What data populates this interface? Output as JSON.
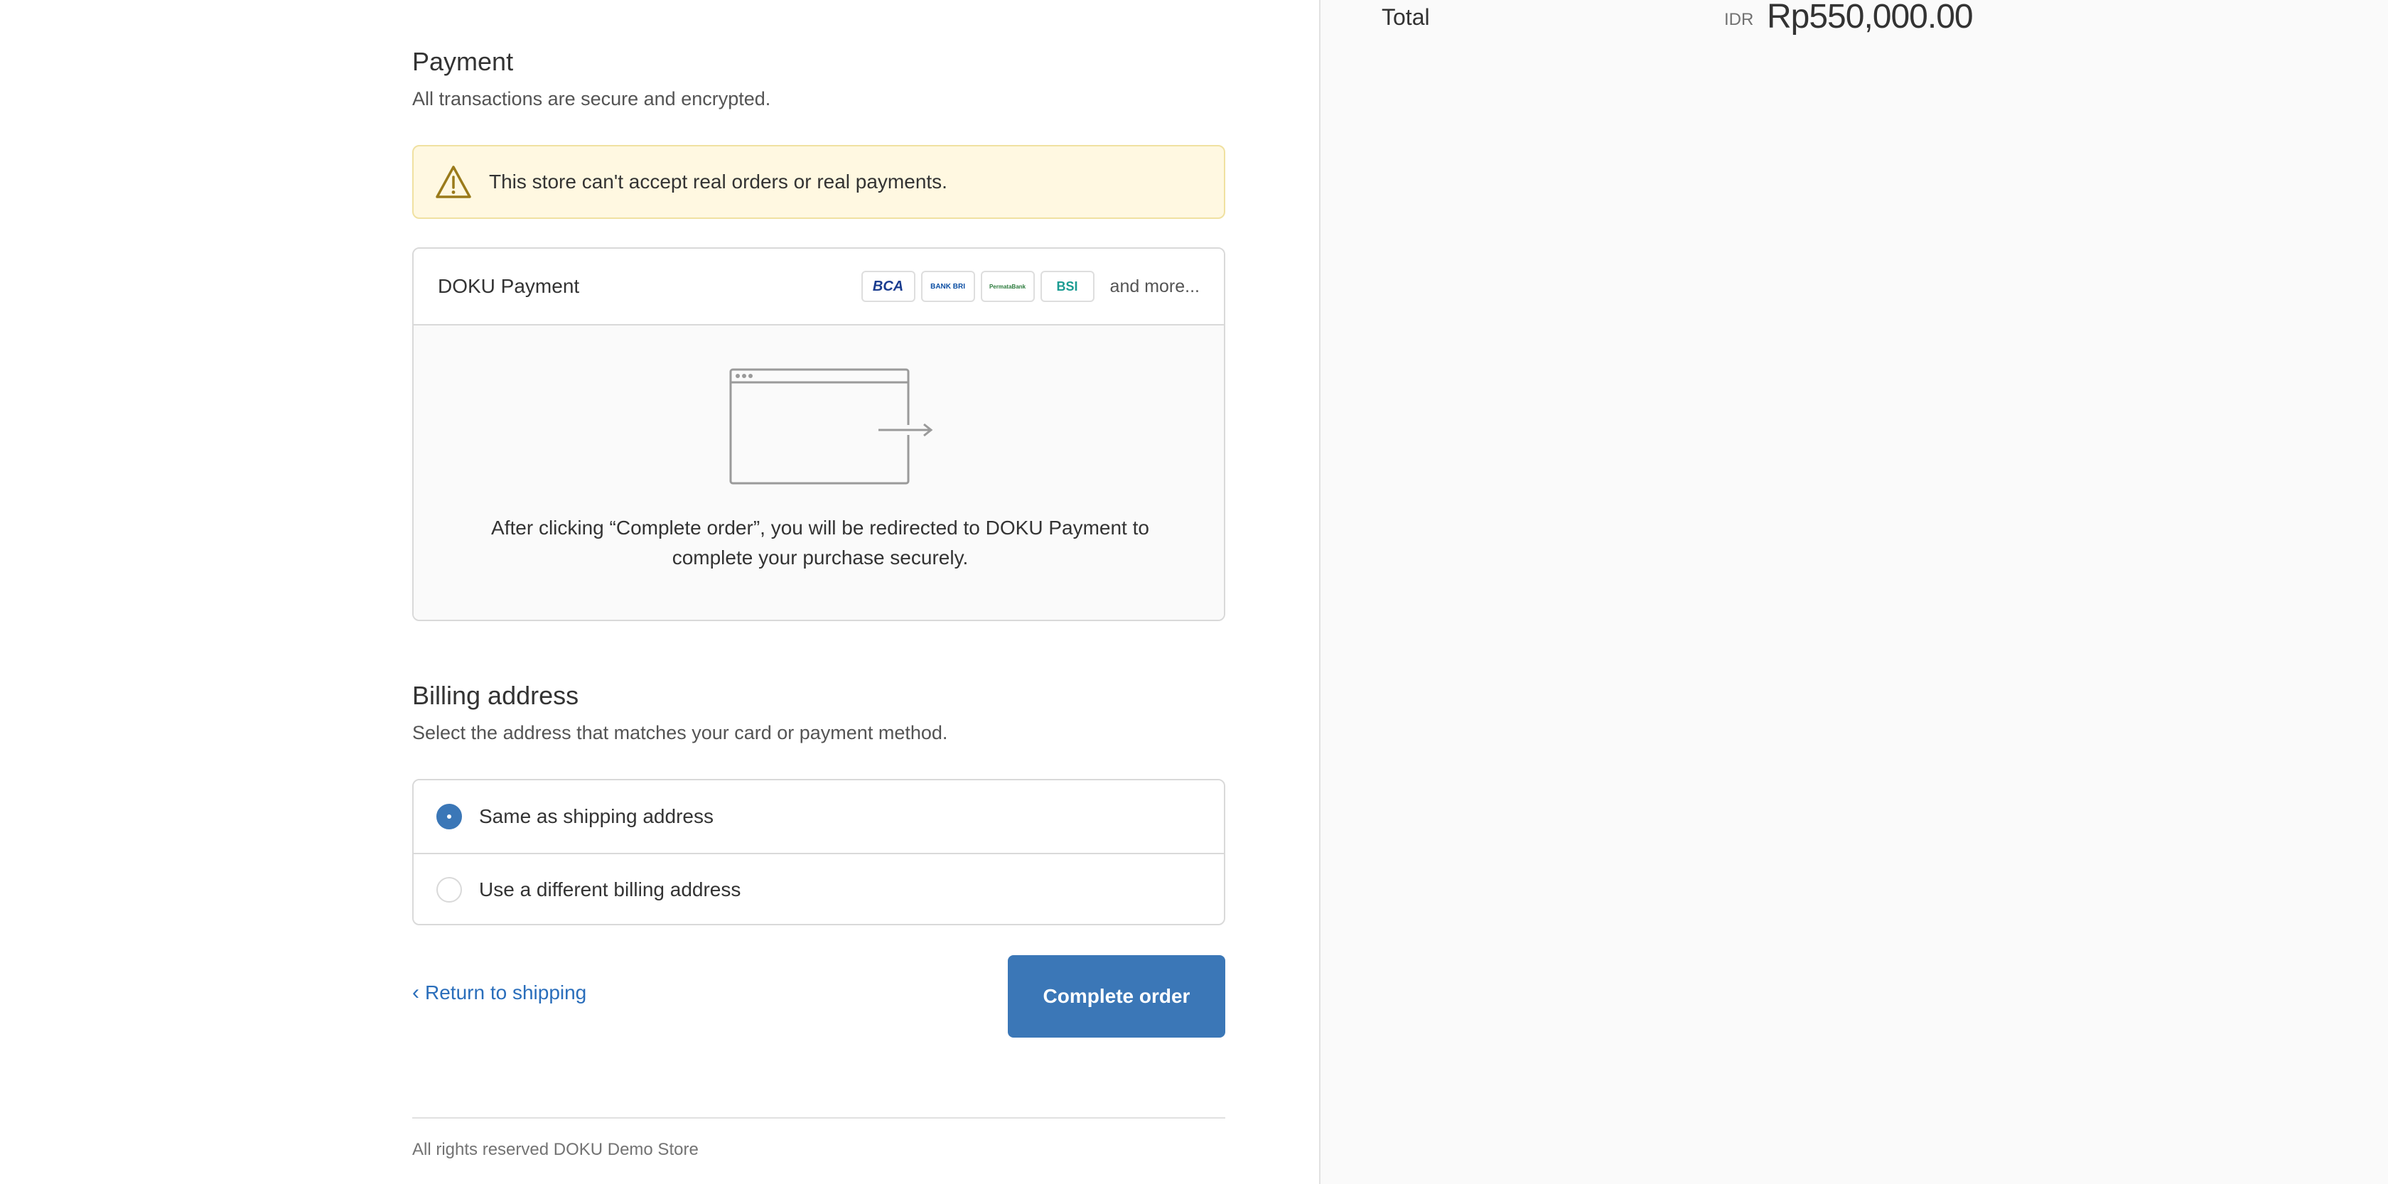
{
  "payment": {
    "title": "Payment",
    "subtitle": "All transactions are secure and encrypted.",
    "warning": "This store can't accept real orders or real payments.",
    "method_name": "DOKU Payment",
    "logos": [
      "BCA",
      "BANK BRI",
      "PermataBank",
      "BSI"
    ],
    "more_label": "and more...",
    "redirect_text": "After clicking “Complete order”, you will be redirected to DOKU Payment to complete your purchase securely."
  },
  "billing": {
    "title": "Billing address",
    "subtitle": "Select the address that matches your card or payment method.",
    "options": [
      {
        "label": "Same as shipping address",
        "selected": true
      },
      {
        "label": "Use a different billing address",
        "selected": false
      }
    ]
  },
  "actions": {
    "return_label": "Return to shipping",
    "complete_label": "Complete order"
  },
  "footer": {
    "text": "All rights reserved DOKU Demo Store"
  },
  "summary": {
    "total_label": "Total",
    "currency": "IDR",
    "total_value": "Rp550,000.00"
  },
  "colors": {
    "accent": "#3b77b7",
    "link": "#2a6ebb",
    "warning_bg": "#fff8e1",
    "sidebar_bg": "#fafafa"
  }
}
